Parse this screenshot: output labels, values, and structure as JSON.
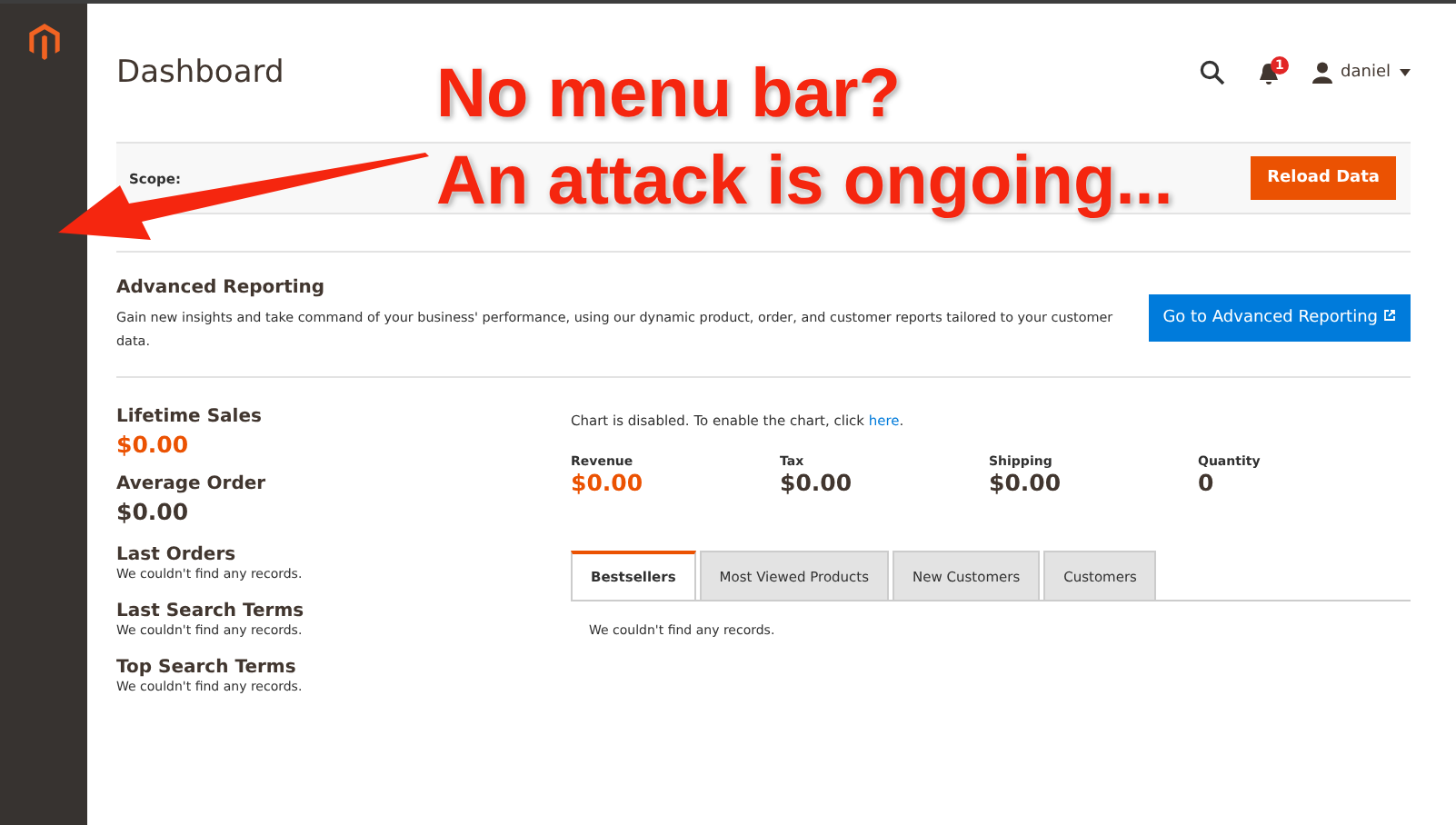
{
  "page_title": "Dashboard",
  "header": {
    "notifications": "1",
    "user": "daniel"
  },
  "scope": {
    "label": "Scope:"
  },
  "reload_button": "Reload Data",
  "advanced_reporting": {
    "title": "Advanced Reporting",
    "description": "Gain new insights and take command of your business' performance, using our dynamic product, order, and customer reports tailored to your customer data.",
    "button": "Go to Advanced Reporting"
  },
  "lifetime_sales": {
    "label": "Lifetime Sales",
    "value": "$0.00"
  },
  "average_order": {
    "label": "Average Order",
    "value": "$0.00"
  },
  "sections": [
    {
      "title": "Last Orders",
      "message": "We couldn't find any records."
    },
    {
      "title": "Last Search Terms",
      "message": "We couldn't find any records."
    },
    {
      "title": "Top Search Terms",
      "message": "We couldn't find any records."
    }
  ],
  "chart_notice": {
    "text": "Chart is disabled. To enable the chart, click ",
    "link": "here",
    "end": "."
  },
  "totals": [
    {
      "label": "Revenue",
      "value": "$0.00",
      "kind": "accent"
    },
    {
      "label": "Tax",
      "value": "$0.00",
      "kind": "plain"
    },
    {
      "label": "Shipping",
      "value": "$0.00",
      "kind": "plain"
    },
    {
      "label": "Quantity",
      "value": "0",
      "kind": "plain"
    }
  ],
  "tabs": [
    {
      "label": "Bestsellers",
      "selected": true
    },
    {
      "label": "Most Viewed Products",
      "selected": false
    },
    {
      "label": "New Customers",
      "selected": false
    },
    {
      "label": "Customers",
      "selected": false
    }
  ],
  "tab_message": "We couldn't find any records.",
  "annotation": [
    "No menu bar?",
    "An attack is ongoing..."
  ]
}
